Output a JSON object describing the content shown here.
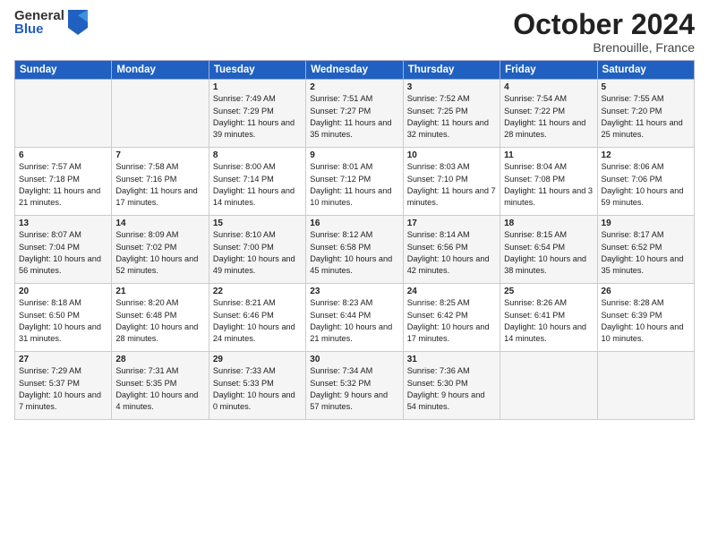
{
  "header": {
    "logo_general": "General",
    "logo_blue": "Blue",
    "month_title": "October 2024",
    "subtitle": "Brenouille, France"
  },
  "days_of_week": [
    "Sunday",
    "Monday",
    "Tuesday",
    "Wednesday",
    "Thursday",
    "Friday",
    "Saturday"
  ],
  "weeks": [
    [
      {
        "day": "",
        "info": ""
      },
      {
        "day": "",
        "info": ""
      },
      {
        "day": "1",
        "info": "Sunrise: 7:49 AM\nSunset: 7:29 PM\nDaylight: 11 hours and 39 minutes."
      },
      {
        "day": "2",
        "info": "Sunrise: 7:51 AM\nSunset: 7:27 PM\nDaylight: 11 hours and 35 minutes."
      },
      {
        "day": "3",
        "info": "Sunrise: 7:52 AM\nSunset: 7:25 PM\nDaylight: 11 hours and 32 minutes."
      },
      {
        "day": "4",
        "info": "Sunrise: 7:54 AM\nSunset: 7:22 PM\nDaylight: 11 hours and 28 minutes."
      },
      {
        "day": "5",
        "info": "Sunrise: 7:55 AM\nSunset: 7:20 PM\nDaylight: 11 hours and 25 minutes."
      }
    ],
    [
      {
        "day": "6",
        "info": "Sunrise: 7:57 AM\nSunset: 7:18 PM\nDaylight: 11 hours and 21 minutes."
      },
      {
        "day": "7",
        "info": "Sunrise: 7:58 AM\nSunset: 7:16 PM\nDaylight: 11 hours and 17 minutes."
      },
      {
        "day": "8",
        "info": "Sunrise: 8:00 AM\nSunset: 7:14 PM\nDaylight: 11 hours and 14 minutes."
      },
      {
        "day": "9",
        "info": "Sunrise: 8:01 AM\nSunset: 7:12 PM\nDaylight: 11 hours and 10 minutes."
      },
      {
        "day": "10",
        "info": "Sunrise: 8:03 AM\nSunset: 7:10 PM\nDaylight: 11 hours and 7 minutes."
      },
      {
        "day": "11",
        "info": "Sunrise: 8:04 AM\nSunset: 7:08 PM\nDaylight: 11 hours and 3 minutes."
      },
      {
        "day": "12",
        "info": "Sunrise: 8:06 AM\nSunset: 7:06 PM\nDaylight: 10 hours and 59 minutes."
      }
    ],
    [
      {
        "day": "13",
        "info": "Sunrise: 8:07 AM\nSunset: 7:04 PM\nDaylight: 10 hours and 56 minutes."
      },
      {
        "day": "14",
        "info": "Sunrise: 8:09 AM\nSunset: 7:02 PM\nDaylight: 10 hours and 52 minutes."
      },
      {
        "day": "15",
        "info": "Sunrise: 8:10 AM\nSunset: 7:00 PM\nDaylight: 10 hours and 49 minutes."
      },
      {
        "day": "16",
        "info": "Sunrise: 8:12 AM\nSunset: 6:58 PM\nDaylight: 10 hours and 45 minutes."
      },
      {
        "day": "17",
        "info": "Sunrise: 8:14 AM\nSunset: 6:56 PM\nDaylight: 10 hours and 42 minutes."
      },
      {
        "day": "18",
        "info": "Sunrise: 8:15 AM\nSunset: 6:54 PM\nDaylight: 10 hours and 38 minutes."
      },
      {
        "day": "19",
        "info": "Sunrise: 8:17 AM\nSunset: 6:52 PM\nDaylight: 10 hours and 35 minutes."
      }
    ],
    [
      {
        "day": "20",
        "info": "Sunrise: 8:18 AM\nSunset: 6:50 PM\nDaylight: 10 hours and 31 minutes."
      },
      {
        "day": "21",
        "info": "Sunrise: 8:20 AM\nSunset: 6:48 PM\nDaylight: 10 hours and 28 minutes."
      },
      {
        "day": "22",
        "info": "Sunrise: 8:21 AM\nSunset: 6:46 PM\nDaylight: 10 hours and 24 minutes."
      },
      {
        "day": "23",
        "info": "Sunrise: 8:23 AM\nSunset: 6:44 PM\nDaylight: 10 hours and 21 minutes."
      },
      {
        "day": "24",
        "info": "Sunrise: 8:25 AM\nSunset: 6:42 PM\nDaylight: 10 hours and 17 minutes."
      },
      {
        "day": "25",
        "info": "Sunrise: 8:26 AM\nSunset: 6:41 PM\nDaylight: 10 hours and 14 minutes."
      },
      {
        "day": "26",
        "info": "Sunrise: 8:28 AM\nSunset: 6:39 PM\nDaylight: 10 hours and 10 minutes."
      }
    ],
    [
      {
        "day": "27",
        "info": "Sunrise: 7:29 AM\nSunset: 5:37 PM\nDaylight: 10 hours and 7 minutes."
      },
      {
        "day": "28",
        "info": "Sunrise: 7:31 AM\nSunset: 5:35 PM\nDaylight: 10 hours and 4 minutes."
      },
      {
        "day": "29",
        "info": "Sunrise: 7:33 AM\nSunset: 5:33 PM\nDaylight: 10 hours and 0 minutes."
      },
      {
        "day": "30",
        "info": "Sunrise: 7:34 AM\nSunset: 5:32 PM\nDaylight: 9 hours and 57 minutes."
      },
      {
        "day": "31",
        "info": "Sunrise: 7:36 AM\nSunset: 5:30 PM\nDaylight: 9 hours and 54 minutes."
      },
      {
        "day": "",
        "info": ""
      },
      {
        "day": "",
        "info": ""
      }
    ]
  ]
}
